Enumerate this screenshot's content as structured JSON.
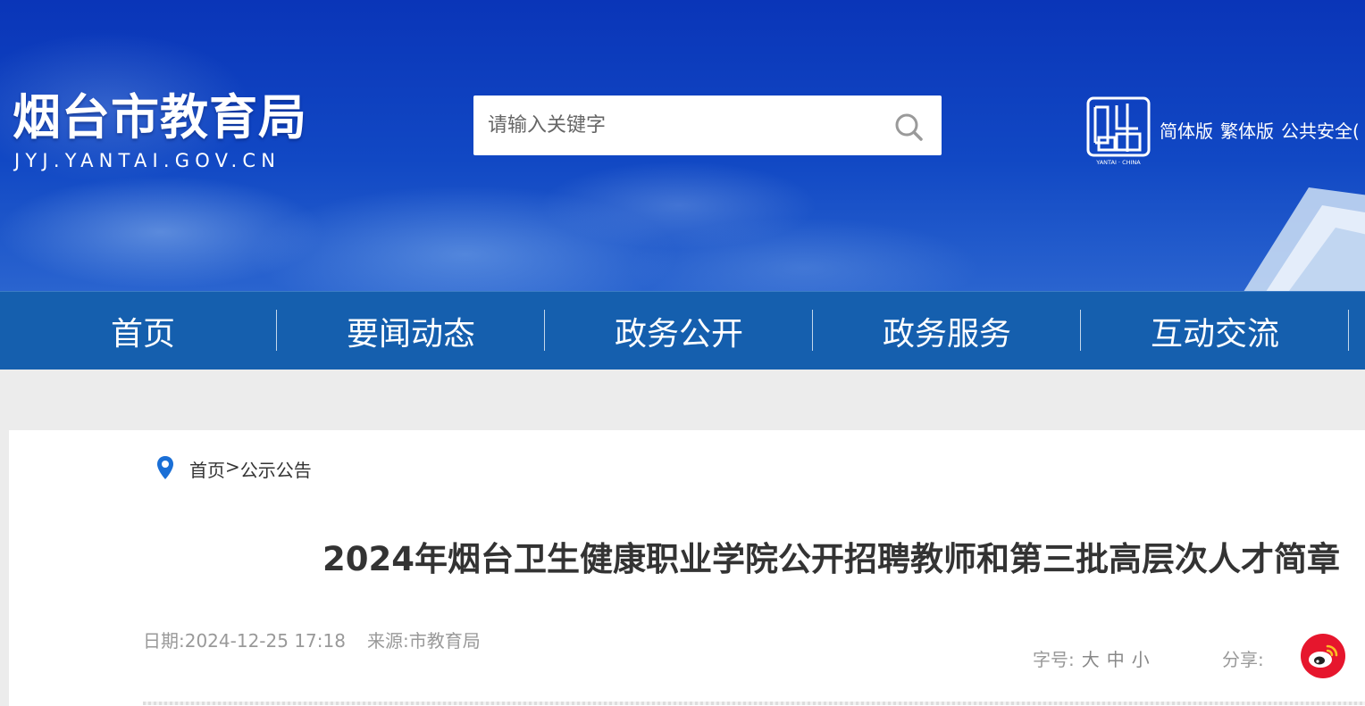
{
  "header": {
    "site_title": "烟台市教育局",
    "site_domain": "JYJ.YANTAI.GOV.CN",
    "search": {
      "placeholder": "请输入关键字",
      "value": ""
    },
    "seal_text": "YANTAI · CHINA",
    "lang_links": [
      "简体版",
      "繁体版",
      "公共安全(",
      ""
    ]
  },
  "nav": {
    "items": [
      "首页",
      "要闻动态",
      "政务公开",
      "政务服务",
      "互动交流"
    ]
  },
  "breadcrumb": {
    "home": "首页",
    "separator": ">",
    "current": "公示公告"
  },
  "article": {
    "title": "2024年烟台卫生健康职业学院公开招聘教师和第三批高层次人才简章",
    "date": "日期:2024-12-25 17:18",
    "source": "来源:市教育局"
  },
  "tools": {
    "fontsize_label": "字号:",
    "fontsize_options": [
      "大",
      "中",
      "小"
    ],
    "share_label": "分享:"
  },
  "colors": {
    "nav_bg": "#155fae",
    "banner": "#0a35b8",
    "weibo": "#e6162d",
    "location": "#1a6fd6"
  },
  "icons": [
    "search-icon",
    "location-icon",
    "weibo-icon",
    "yantai-seal-logo"
  ]
}
